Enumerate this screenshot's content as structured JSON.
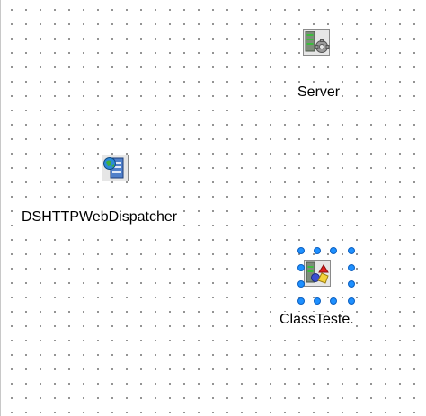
{
  "designer": {
    "components": [
      {
        "id": "server",
        "label": "Server",
        "icon": "server-gear-icon",
        "selected": false
      },
      {
        "id": "dispatcher",
        "label": "DSHTTPWebDispatcher",
        "icon": "web-dispatcher-globe-icon",
        "selected": false
      },
      {
        "id": "classteste",
        "label": "ClassTeste.",
        "icon": "server-class-icon",
        "selected": true
      }
    ]
  },
  "colors": {
    "grid_dot": "#7f7f7f",
    "selection_handle": "#1e90ff"
  }
}
